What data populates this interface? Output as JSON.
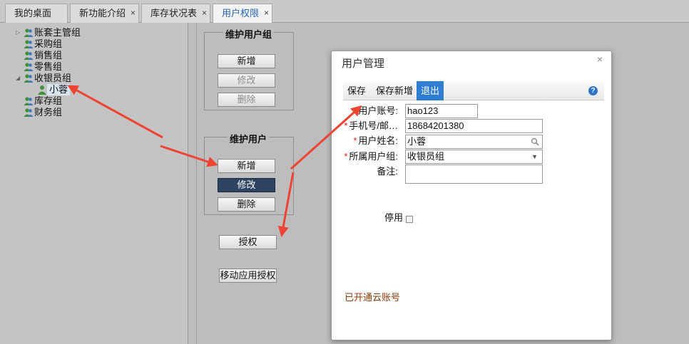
{
  "tabs": [
    {
      "label": "我的桌面",
      "closable": false,
      "active": false
    },
    {
      "label": "新功能介绍",
      "closable": true,
      "active": false
    },
    {
      "label": "库存状况表",
      "closable": true,
      "active": false
    },
    {
      "label": "用户权限",
      "closable": true,
      "active": true
    }
  ],
  "tab_close_glyph": "×",
  "tree": {
    "items": [
      {
        "label": "账套主管组",
        "level": 0,
        "expandable": true,
        "expanded": false
      },
      {
        "label": "采购组",
        "level": 0
      },
      {
        "label": "销售组",
        "level": 0
      },
      {
        "label": "零售组",
        "level": 0
      },
      {
        "label": "收银员组",
        "level": 0,
        "expandable": true,
        "expanded": true
      },
      {
        "label": "小蓉",
        "level": 1,
        "selected": true,
        "type": "user"
      },
      {
        "label": "库存组",
        "level": 0
      },
      {
        "label": "财务组",
        "level": 0
      }
    ]
  },
  "group_panel": {
    "legend": "维护用户组",
    "add": "新增",
    "edit": "修改",
    "delete": "删除"
  },
  "user_panel": {
    "legend": "维护用户",
    "add": "新增",
    "edit": "修改",
    "delete": "删除"
  },
  "authorize_button": "授权",
  "mobile_authorize_button": "移动应用授权",
  "dialog": {
    "title": "用户管理",
    "close_glyph": "×",
    "toolbar": {
      "save": "保存",
      "save_new": "保存新增",
      "exit": "退出",
      "help_glyph": "?"
    },
    "fields": {
      "account_label": "用户账号:",
      "account_value": "hao123",
      "phone_label": "手机号/邮…",
      "phone_value": "18684201380",
      "name_label": "用户姓名:",
      "name_value": "小蓉",
      "group_label": "所属用户组:",
      "group_value": "收银员组",
      "remark_label": "备注:",
      "remark_value": "",
      "disabled_label": "停用",
      "disabled_checked": false
    },
    "required_mark": "*",
    "cloud_note": "已开通云账号"
  },
  "colors": {
    "accent": "#2e7dd1",
    "required": "#d41e1e",
    "arrow": "#ee4433",
    "note": "#8b3a0a",
    "dark_button": "#2d4463"
  },
  "icons": {
    "group": "users-group-icon",
    "user": "user-icon",
    "search": "search-icon",
    "dropdown": "chevron-down-icon",
    "help": "help-icon",
    "close": "close-icon"
  }
}
